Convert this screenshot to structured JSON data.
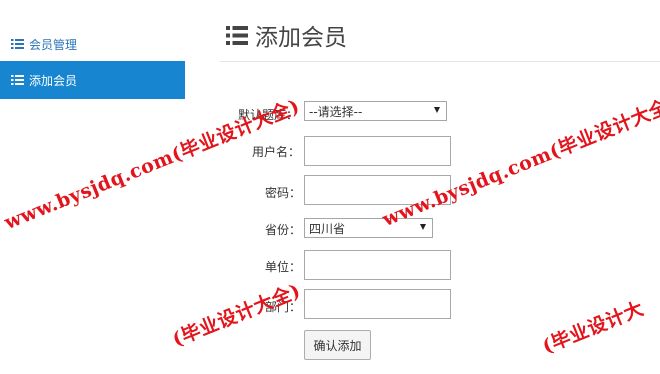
{
  "sidebar": {
    "items": [
      {
        "label": "会员管理",
        "icon": "list-icon",
        "active": false
      },
      {
        "label": "添加会员",
        "icon": "list-icon",
        "active": true
      }
    ]
  },
  "header": {
    "title": "添加会员",
    "icon": "list-icon"
  },
  "form": {
    "question_bank": {
      "label": "默认题库：",
      "value": "--请选择--"
    },
    "username": {
      "label": "用户名：",
      "value": ""
    },
    "password": {
      "label": "密码：",
      "value": ""
    },
    "province": {
      "label": "省份：",
      "value": "四川省"
    },
    "unit": {
      "label": "单位：",
      "value": ""
    },
    "department": {
      "label": "部门：",
      "value": ""
    },
    "submit_label": "确认添加"
  },
  "watermarks": {
    "wm1": "www.bysjdq.com(毕业设计大全)",
    "wm2": "www.bysjdq.com(毕业设计大全)",
    "wm3": "(毕业设计大全)",
    "wm4": "(毕业设计大"
  },
  "colors": {
    "accent": "#1785d0",
    "link": "#2a74b8",
    "watermark": "#e3141b"
  }
}
